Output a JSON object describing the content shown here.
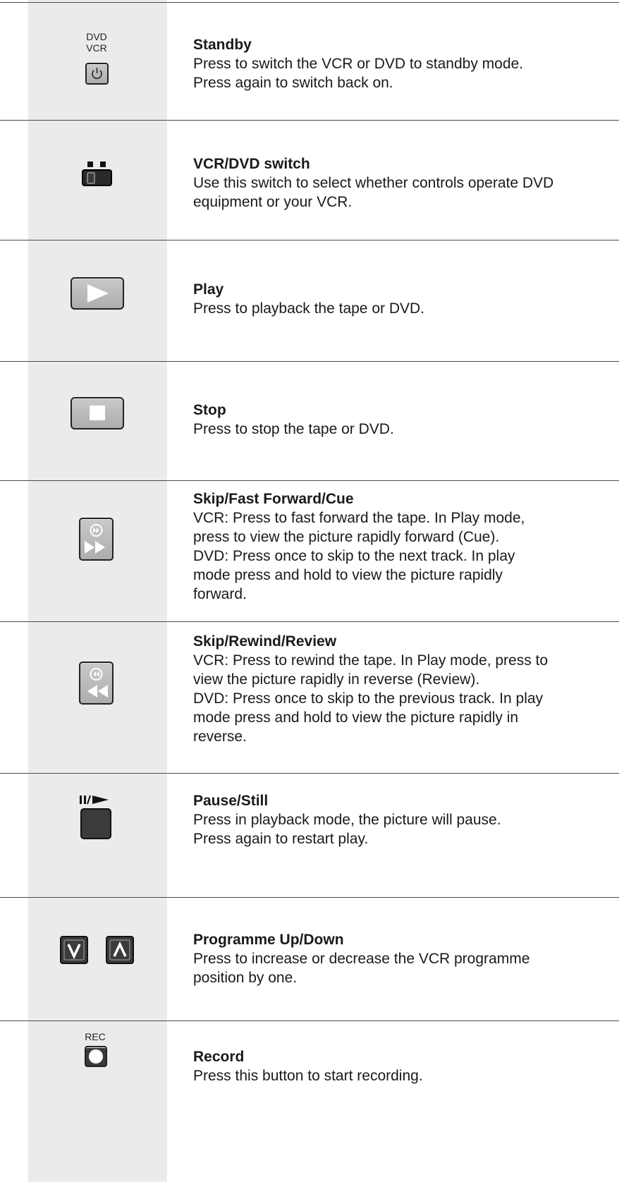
{
  "rows": [
    {
      "icon": "standby-icon",
      "labels": [
        "DVD",
        "VCR"
      ],
      "title": "Standby",
      "description": "Press to switch the VCR or DVD to standby mode.\nPress again to switch back on."
    },
    {
      "icon": "vcr-dvd-switch-icon",
      "title": "VCR/DVD switch",
      "description": "Use this switch to select whether controls operate DVD\nequipment or your VCR."
    },
    {
      "icon": "play-icon",
      "title": "Play",
      "description": "Press to playback the tape or DVD."
    },
    {
      "icon": "stop-icon",
      "title": "Stop",
      "description": "Press to stop the tape or DVD."
    },
    {
      "icon": "fast-forward-icon",
      "title": "Skip/Fast Forward/Cue",
      "description": "VCR: Press to fast forward the tape. In Play mode,\npress to view the picture rapidly forward (Cue).\nDVD: Press once to skip to the next track. In play\nmode press and hold to view the picture rapidly\nforward."
    },
    {
      "icon": "rewind-icon",
      "title": "Skip/Rewind/Review",
      "description": "VCR: Press to rewind the tape. In Play mode, press to\nview the picture rapidly in reverse (Review).\nDVD: Press once to skip to the previous track. In play\nmode press and hold to view the picture rapidly in\nreverse."
    },
    {
      "icon": "pause-still-icon",
      "title": "Pause/Still",
      "description": "Press in playback mode, the picture will pause.\nPress again to restart play."
    },
    {
      "icon": "programme-up-down-icon",
      "title": "Programme Up/Down",
      "description": "Press to increase or decrease the VCR programme\nposition by one."
    },
    {
      "icon": "record-icon",
      "labels": [
        "REC"
      ],
      "title": "Record",
      "description": "Press this button to start recording."
    }
  ]
}
